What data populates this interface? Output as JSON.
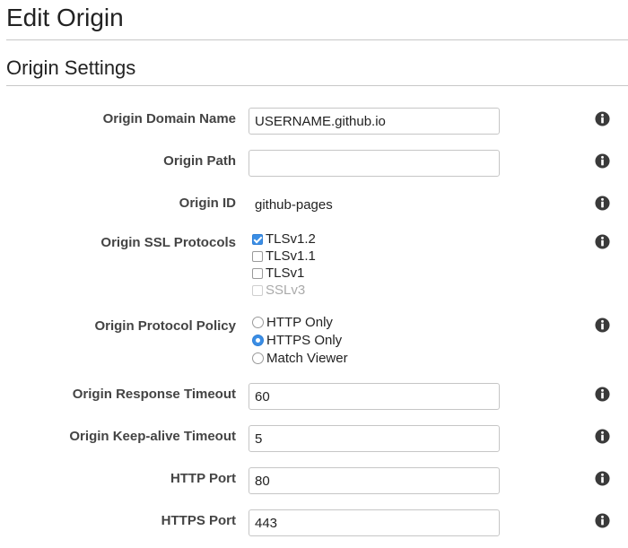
{
  "page_title": "Edit Origin",
  "section_title": "Origin Settings",
  "fields": {
    "origin_domain_name": {
      "label": "Origin Domain Name",
      "value": "USERNAME.github.io"
    },
    "origin_path": {
      "label": "Origin Path",
      "value": ""
    },
    "origin_id": {
      "label": "Origin ID",
      "value": "github-pages"
    },
    "origin_ssl_protocols": {
      "label": "Origin SSL Protocols",
      "options": [
        {
          "label": "TLSv1.2",
          "checked": true,
          "disabled": false
        },
        {
          "label": "TLSv1.1",
          "checked": false,
          "disabled": false
        },
        {
          "label": "TLSv1",
          "checked": false,
          "disabled": false
        },
        {
          "label": "SSLv3",
          "checked": false,
          "disabled": true
        }
      ]
    },
    "origin_protocol_policy": {
      "label": "Origin Protocol Policy",
      "options": [
        {
          "label": "HTTP Only",
          "selected": false
        },
        {
          "label": "HTTPS Only",
          "selected": true
        },
        {
          "label": "Match Viewer",
          "selected": false
        }
      ]
    },
    "origin_response_timeout": {
      "label": "Origin Response Timeout",
      "value": "60"
    },
    "origin_keepalive_timeout": {
      "label": "Origin Keep-alive Timeout",
      "value": "5"
    },
    "http_port": {
      "label": "HTTP Port",
      "value": "80"
    },
    "https_port": {
      "label": "HTTPS Port",
      "value": "443"
    }
  },
  "icons": {
    "info": "info-icon"
  },
  "colors": {
    "accent": "#3b8ee5",
    "info_icon": "#3a3a3a"
  }
}
